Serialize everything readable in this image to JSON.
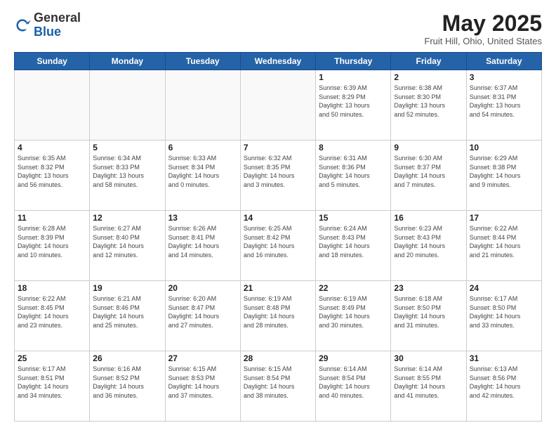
{
  "header": {
    "logo_general": "General",
    "logo_blue": "Blue",
    "month_title": "May 2025",
    "location": "Fruit Hill, Ohio, United States"
  },
  "weekdays": [
    "Sunday",
    "Monday",
    "Tuesday",
    "Wednesday",
    "Thursday",
    "Friday",
    "Saturday"
  ],
  "weeks": [
    [
      {
        "day": "",
        "info": ""
      },
      {
        "day": "",
        "info": ""
      },
      {
        "day": "",
        "info": ""
      },
      {
        "day": "",
        "info": ""
      },
      {
        "day": "1",
        "info": "Sunrise: 6:39 AM\nSunset: 8:29 PM\nDaylight: 13 hours\nand 50 minutes."
      },
      {
        "day": "2",
        "info": "Sunrise: 6:38 AM\nSunset: 8:30 PM\nDaylight: 13 hours\nand 52 minutes."
      },
      {
        "day": "3",
        "info": "Sunrise: 6:37 AM\nSunset: 8:31 PM\nDaylight: 13 hours\nand 54 minutes."
      }
    ],
    [
      {
        "day": "4",
        "info": "Sunrise: 6:35 AM\nSunset: 8:32 PM\nDaylight: 13 hours\nand 56 minutes."
      },
      {
        "day": "5",
        "info": "Sunrise: 6:34 AM\nSunset: 8:33 PM\nDaylight: 13 hours\nand 58 minutes."
      },
      {
        "day": "6",
        "info": "Sunrise: 6:33 AM\nSunset: 8:34 PM\nDaylight: 14 hours\nand 0 minutes."
      },
      {
        "day": "7",
        "info": "Sunrise: 6:32 AM\nSunset: 8:35 PM\nDaylight: 14 hours\nand 3 minutes."
      },
      {
        "day": "8",
        "info": "Sunrise: 6:31 AM\nSunset: 8:36 PM\nDaylight: 14 hours\nand 5 minutes."
      },
      {
        "day": "9",
        "info": "Sunrise: 6:30 AM\nSunset: 8:37 PM\nDaylight: 14 hours\nand 7 minutes."
      },
      {
        "day": "10",
        "info": "Sunrise: 6:29 AM\nSunset: 8:38 PM\nDaylight: 14 hours\nand 9 minutes."
      }
    ],
    [
      {
        "day": "11",
        "info": "Sunrise: 6:28 AM\nSunset: 8:39 PM\nDaylight: 14 hours\nand 10 minutes."
      },
      {
        "day": "12",
        "info": "Sunrise: 6:27 AM\nSunset: 8:40 PM\nDaylight: 14 hours\nand 12 minutes."
      },
      {
        "day": "13",
        "info": "Sunrise: 6:26 AM\nSunset: 8:41 PM\nDaylight: 14 hours\nand 14 minutes."
      },
      {
        "day": "14",
        "info": "Sunrise: 6:25 AM\nSunset: 8:42 PM\nDaylight: 14 hours\nand 16 minutes."
      },
      {
        "day": "15",
        "info": "Sunrise: 6:24 AM\nSunset: 8:43 PM\nDaylight: 14 hours\nand 18 minutes."
      },
      {
        "day": "16",
        "info": "Sunrise: 6:23 AM\nSunset: 8:43 PM\nDaylight: 14 hours\nand 20 minutes."
      },
      {
        "day": "17",
        "info": "Sunrise: 6:22 AM\nSunset: 8:44 PM\nDaylight: 14 hours\nand 21 minutes."
      }
    ],
    [
      {
        "day": "18",
        "info": "Sunrise: 6:22 AM\nSunset: 8:45 PM\nDaylight: 14 hours\nand 23 minutes."
      },
      {
        "day": "19",
        "info": "Sunrise: 6:21 AM\nSunset: 8:46 PM\nDaylight: 14 hours\nand 25 minutes."
      },
      {
        "day": "20",
        "info": "Sunrise: 6:20 AM\nSunset: 8:47 PM\nDaylight: 14 hours\nand 27 minutes."
      },
      {
        "day": "21",
        "info": "Sunrise: 6:19 AM\nSunset: 8:48 PM\nDaylight: 14 hours\nand 28 minutes."
      },
      {
        "day": "22",
        "info": "Sunrise: 6:19 AM\nSunset: 8:49 PM\nDaylight: 14 hours\nand 30 minutes."
      },
      {
        "day": "23",
        "info": "Sunrise: 6:18 AM\nSunset: 8:50 PM\nDaylight: 14 hours\nand 31 minutes."
      },
      {
        "day": "24",
        "info": "Sunrise: 6:17 AM\nSunset: 8:50 PM\nDaylight: 14 hours\nand 33 minutes."
      }
    ],
    [
      {
        "day": "25",
        "info": "Sunrise: 6:17 AM\nSunset: 8:51 PM\nDaylight: 14 hours\nand 34 minutes."
      },
      {
        "day": "26",
        "info": "Sunrise: 6:16 AM\nSunset: 8:52 PM\nDaylight: 14 hours\nand 36 minutes."
      },
      {
        "day": "27",
        "info": "Sunrise: 6:15 AM\nSunset: 8:53 PM\nDaylight: 14 hours\nand 37 minutes."
      },
      {
        "day": "28",
        "info": "Sunrise: 6:15 AM\nSunset: 8:54 PM\nDaylight: 14 hours\nand 38 minutes."
      },
      {
        "day": "29",
        "info": "Sunrise: 6:14 AM\nSunset: 8:54 PM\nDaylight: 14 hours\nand 40 minutes."
      },
      {
        "day": "30",
        "info": "Sunrise: 6:14 AM\nSunset: 8:55 PM\nDaylight: 14 hours\nand 41 minutes."
      },
      {
        "day": "31",
        "info": "Sunrise: 6:13 AM\nSunset: 8:56 PM\nDaylight: 14 hours\nand 42 minutes."
      }
    ]
  ]
}
